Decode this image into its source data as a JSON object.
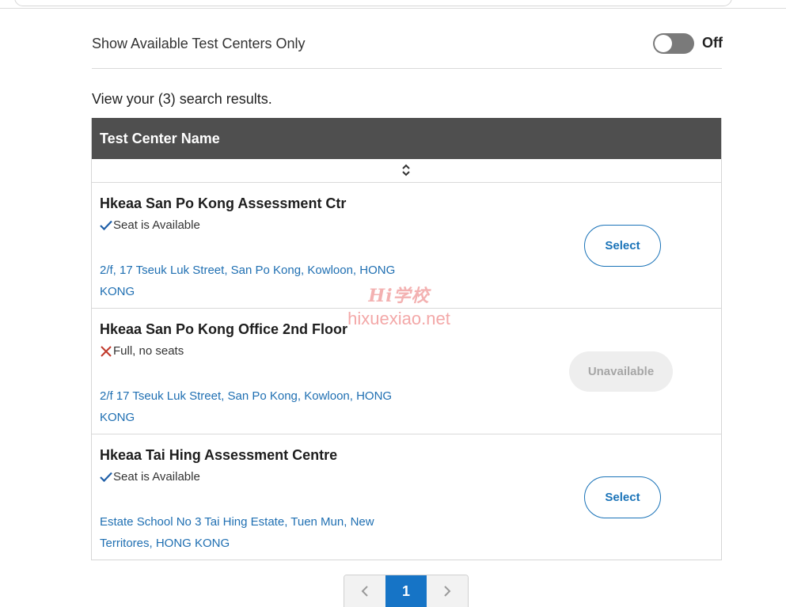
{
  "filter": {
    "label": "Show Available Test Centers Only",
    "toggle_state": "Off"
  },
  "results": {
    "summary": "View your (3) search results."
  },
  "table": {
    "header": "Test Center Name",
    "rows": [
      {
        "name": "Hkeaa San Po Kong Assessment Ctr",
        "status": "Seat is Available",
        "status_icon": "check-icon",
        "address_line1": "2/f, 17 Tseuk Luk Street, San Po Kong, Kowloon, HONG",
        "address_line2": "KONG",
        "action": "Select"
      },
      {
        "name": "Hkeaa San Po Kong Office 2nd Floor",
        "status": "Full, no seats",
        "status_icon": "x-icon",
        "address_line1": "2/f 17 Tseuk Luk Street, San Po Kong, Kowloon, HONG",
        "address_line2": "KONG",
        "action": "Unavailable"
      },
      {
        "name": "Hkeaa Tai Hing Assessment Centre",
        "status": "Seat is Available",
        "status_icon": "check-icon",
        "address_line1": "Estate School No 3 Tai Hing Estate, Tuen Mun, New",
        "address_line2": "Territores, HONG KONG",
        "action": "Select"
      }
    ]
  },
  "watermark": {
    "logo": "Hi学校",
    "site": "hixuexiao.net"
  },
  "pagination": {
    "current_page": "1"
  },
  "colors": {
    "accent": "#1a73b8",
    "header_bg": "#4f4f4f",
    "available": "#1f5fa8",
    "full": "#c0392b"
  }
}
